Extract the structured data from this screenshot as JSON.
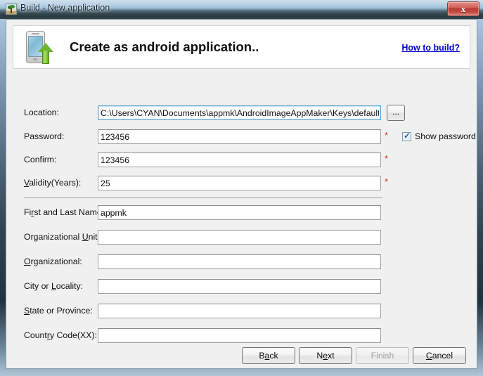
{
  "window": {
    "title": "Build - New application",
    "icon": "image-tree-icon",
    "close_label": "x"
  },
  "header": {
    "icon": "android-phone-upload-icon",
    "title": "Create as android application..",
    "help_link": "How to build?"
  },
  "form": {
    "location": {
      "label": "Location:",
      "value": "C:\\Users\\CYAN\\Documents\\appmk\\AndroidImageAppMaker\\Keys\\default.key",
      "browse_label": "...",
      "required": false,
      "focused": true
    },
    "password": {
      "label": "Password:",
      "value": "123456",
      "required_marker": "*"
    },
    "confirm": {
      "label": "Confirm:",
      "value": "123456",
      "required_marker": "*"
    },
    "validity": {
      "label_pre": "V",
      "label_post": "alidity(Years):",
      "value": "25",
      "required_marker": "*"
    },
    "show_password": {
      "label": "Show password",
      "checked": true,
      "check_glyph": "✓"
    },
    "first_last_name": {
      "label_pre": "Fi",
      "label_mid": "r",
      "label_post": "st and Last Name:",
      "value": "appmk"
    },
    "org_unit": {
      "label_a": "Organizational ",
      "label_b": "U",
      "label_c": "nit:",
      "value": ""
    },
    "organizational": {
      "label_b": "O",
      "label_c": "rganizational:",
      "value": ""
    },
    "city": {
      "label_a": "City or ",
      "label_b": "L",
      "label_c": "ocality:",
      "value": ""
    },
    "state": {
      "label_b": "S",
      "label_c": "tate or Province:",
      "value": ""
    },
    "country": {
      "label_a": "Count",
      "label_b": "r",
      "label_c": "y Code(XX):",
      "value": ""
    }
  },
  "buttons": {
    "back": {
      "pre": "B",
      "mn": "a",
      "post": "ck"
    },
    "next": {
      "pre": "N",
      "mn": "e",
      "post": "xt"
    },
    "finish": {
      "label": "Finish",
      "disabled": true
    },
    "cancel": {
      "pre": "",
      "mn": "C",
      "post": "ancel"
    }
  },
  "colors": {
    "link": "#0000cc",
    "required": "#d03030",
    "focus_border": "#5a9fd4",
    "window_chrome": "#2b3b41"
  }
}
